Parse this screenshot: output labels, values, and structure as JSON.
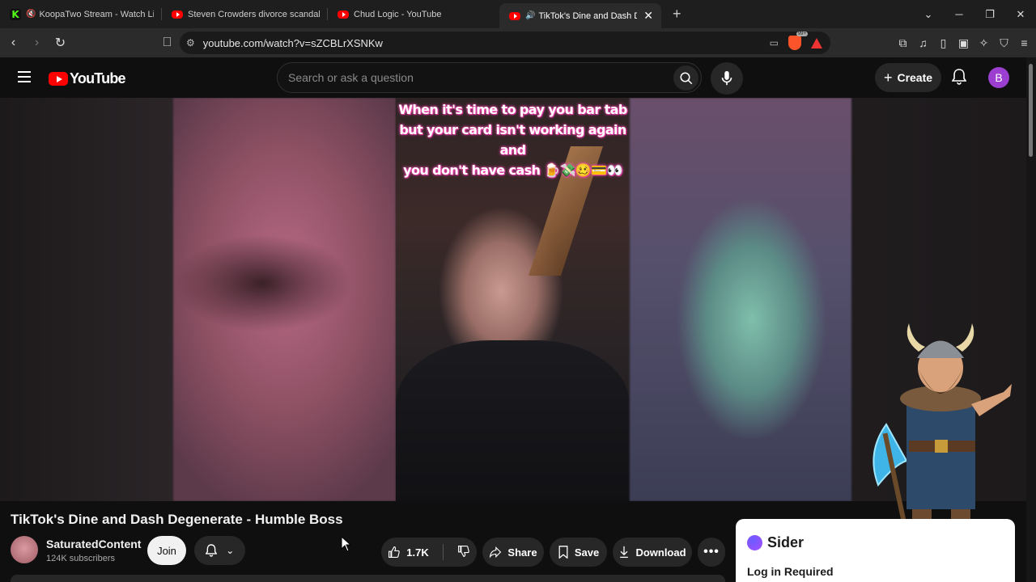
{
  "browser": {
    "tabs": [
      {
        "favicon": "kick-icon",
        "muted": true,
        "title": "KoopaTwo Stream - Watch Live o"
      },
      {
        "favicon": "youtube-icon",
        "muted": false,
        "title": "Steven Crowders divorce scandal | RE"
      },
      {
        "favicon": "youtube-icon",
        "muted": false,
        "title": "Chud Logic - YouTube"
      },
      {
        "favicon": "youtube-icon",
        "muted": true,
        "title": "TikTok's Dine and Dash Degen",
        "active": true
      }
    ],
    "url": "youtube.com/watch?v=sZCBLrXSNKw",
    "brave_badge": "99+"
  },
  "youtube": {
    "logo_text": "YouTube",
    "search_placeholder": "Search or ask a question",
    "create_label": "Create",
    "avatar_letter": "B"
  },
  "video": {
    "caption_lines": [
      "When it's time to pay you bar tab",
      "but your card isn't working again and",
      "you don't have cash 🍺💸🥴💳👀"
    ]
  },
  "meta": {
    "title": "TikTok's Dine and Dash Degenerate - Humble Boss",
    "channel_name": "SaturatedContent",
    "subscribers": "124K subscribers",
    "join_label": "Join",
    "likes": "1.7K",
    "share_label": "Share",
    "save_label": "Save",
    "download_label": "Download"
  },
  "sider": {
    "brand": "Sider",
    "login_text": "Log in Required"
  },
  "colors": {
    "youtube_red": "#ff0000",
    "avatar_purple": "#9c3fd0",
    "caption_glow": "#ff49b6",
    "background": "#0f0f0f"
  }
}
